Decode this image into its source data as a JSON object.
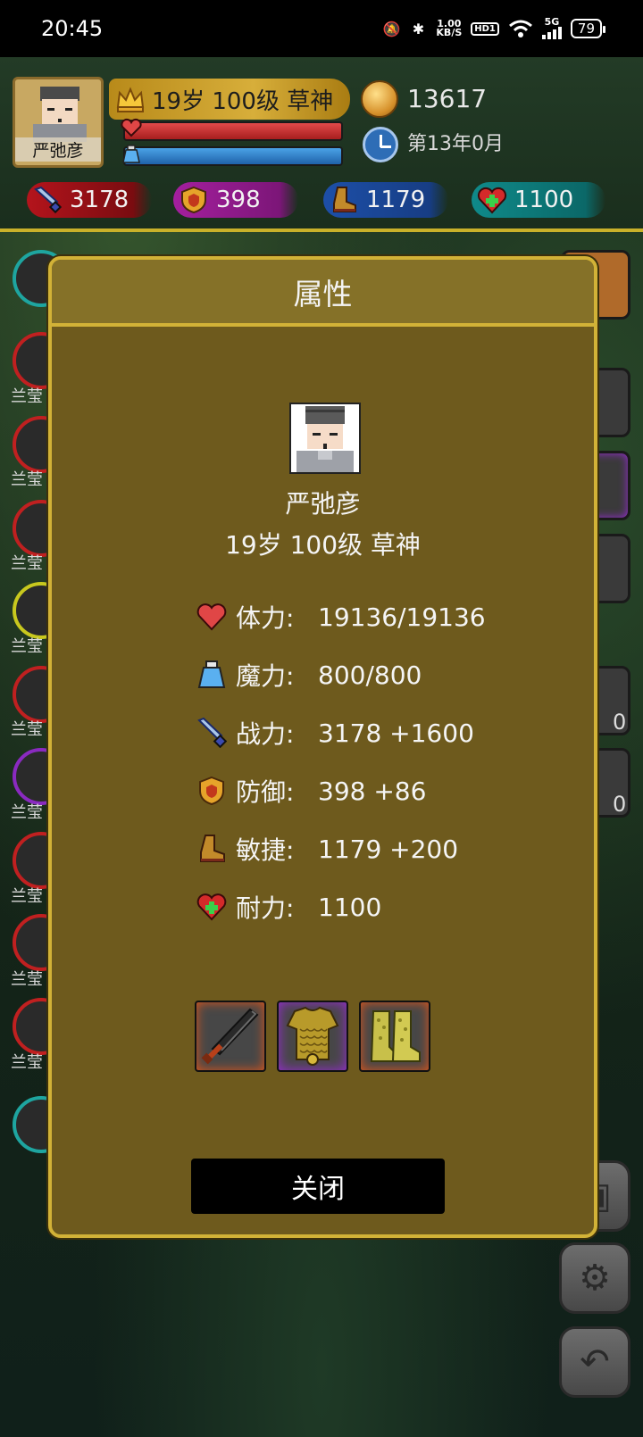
{
  "status_bar": {
    "time": "20:45",
    "network_speed_value": "1.00",
    "network_speed_unit": "KB/S",
    "hd_badge": "HD1",
    "signal_label": "5G",
    "battery": "79"
  },
  "hud": {
    "player_name": "严弛彦",
    "title": "19岁 100级 草神",
    "gold": "13617",
    "date": "第13年0月",
    "hp_fraction": 1.0,
    "mp_fraction": 1.0,
    "stats": {
      "attack": "3178",
      "defense": "398",
      "agility": "1179",
      "endurance": "1100"
    }
  },
  "side_labels": [
    "兰莹",
    "兰莹",
    "兰莹",
    "兰莹",
    "兰莹",
    "兰莹",
    "兰莹",
    "兰莹",
    "兰莹"
  ],
  "right_counts": [
    "0",
    "0"
  ],
  "modal": {
    "title": "属性",
    "name": "严弛彦",
    "info": "19岁 100级 草神",
    "attributes": [
      {
        "icon": "heart-icon",
        "label": "体力:",
        "value": "19136/19136"
      },
      {
        "icon": "potion-icon",
        "label": "魔力:",
        "value": "800/800"
      },
      {
        "icon": "sword-icon",
        "label": "战力:",
        "value": "3178 +1600"
      },
      {
        "icon": "shield-icon",
        "label": "防御:",
        "value": "398 +86"
      },
      {
        "icon": "boot-icon",
        "label": "敏捷:",
        "value": "1179 +200"
      },
      {
        "icon": "heart-plus-icon",
        "label": "耐力:",
        "value": "1100"
      }
    ],
    "equipment": [
      "sword",
      "armor",
      "boots"
    ],
    "close_label": "关闭"
  },
  "colors": {
    "modal_bg": "#6e5a1d",
    "modal_border": "#d2b237",
    "hp_bar": "#d23232",
    "mp_bar": "#2f80cc"
  }
}
